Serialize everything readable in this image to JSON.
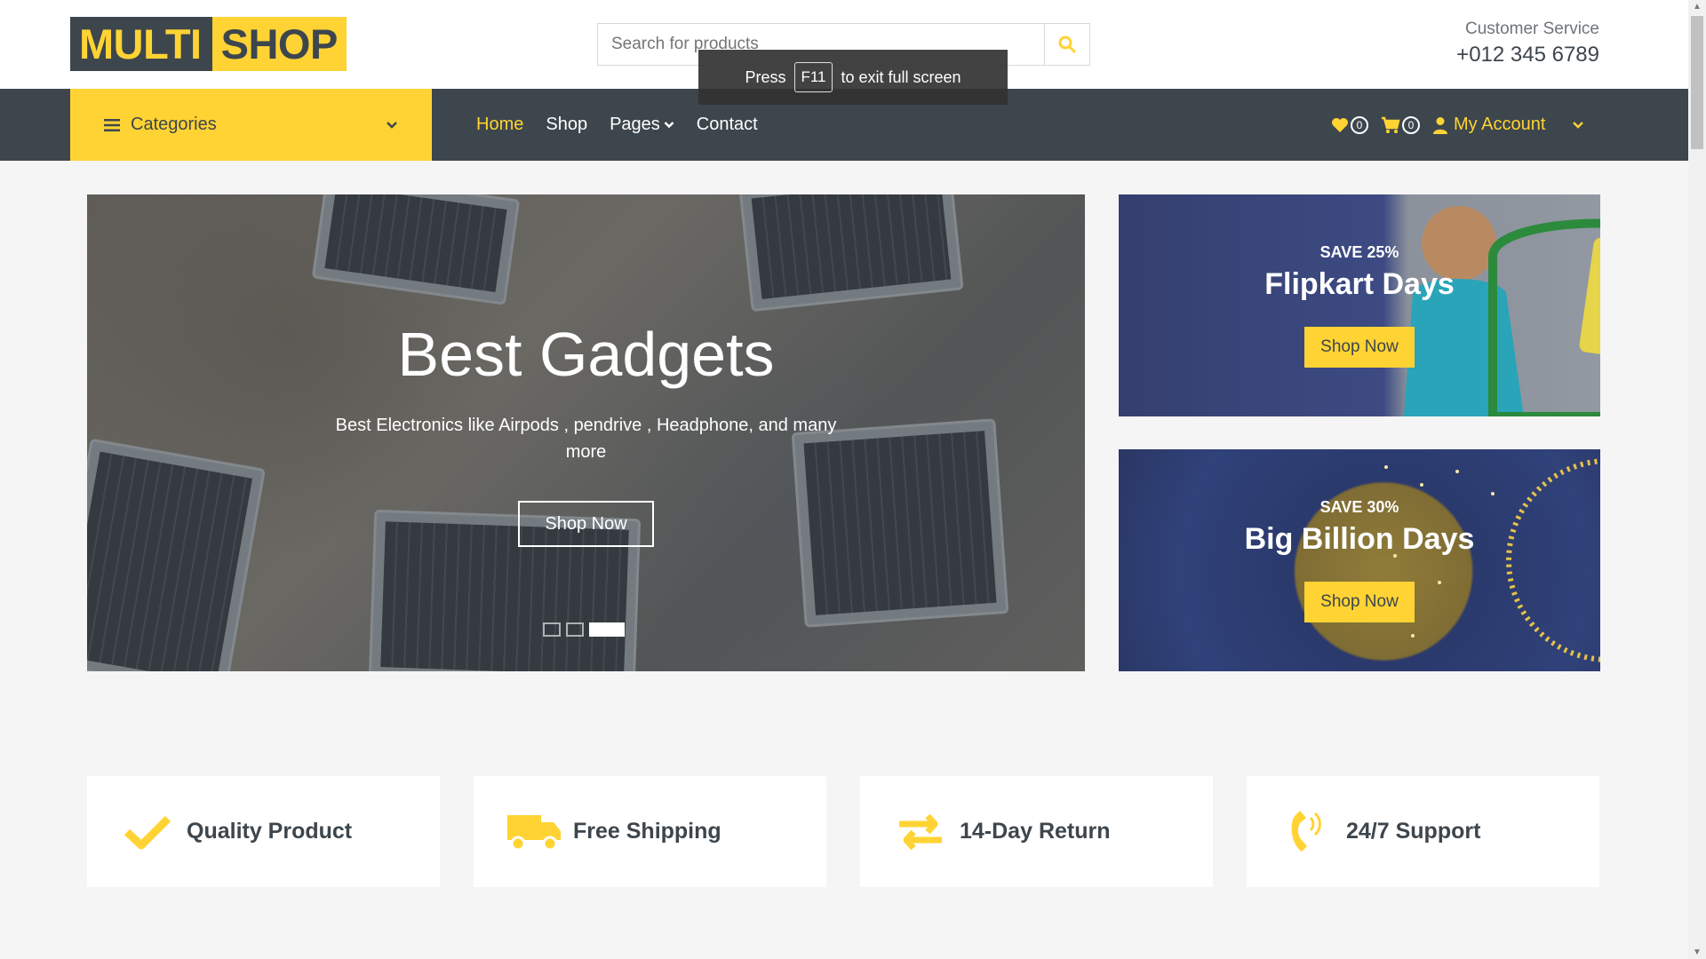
{
  "header": {
    "logo_part1": "MULTI",
    "logo_part2": "SHOP",
    "search_placeholder": "Search for products",
    "customer_service_label": "Customer Service",
    "customer_service_phone": "+012 345 6789"
  },
  "toast": {
    "prefix": "Press",
    "key": "F11",
    "suffix": "to exit full screen"
  },
  "nav": {
    "categories_label": "Categories",
    "items": [
      "Home",
      "Shop",
      "Pages",
      "Contact"
    ],
    "wishlist_count": "0",
    "cart_count": "0",
    "account_label": "My Account"
  },
  "hero": {
    "title": "Best Gadgets",
    "subtitle": "Best Electronics like Airpods , pendrive , Headphone, and many more",
    "button": "Shop Now",
    "slides": 3,
    "active_slide": 3
  },
  "offers": [
    {
      "save": "SAVE 25%",
      "name": "Flipkart Days",
      "button": "Shop Now"
    },
    {
      "save": "SAVE 30%",
      "name": "Big Billion Days",
      "button": "Shop Now"
    }
  ],
  "features": [
    {
      "icon": "check-icon",
      "label": "Quality Product"
    },
    {
      "icon": "shipping-truck-icon",
      "label": "Free Shipping"
    },
    {
      "icon": "exchange-arrows-icon",
      "label": "14-Day Return"
    },
    {
      "icon": "phone-volume-icon",
      "label": "24/7 Support"
    }
  ],
  "colors": {
    "primary": "#ffd333",
    "dark": "#3d464d",
    "background": "#f5f5f5"
  }
}
